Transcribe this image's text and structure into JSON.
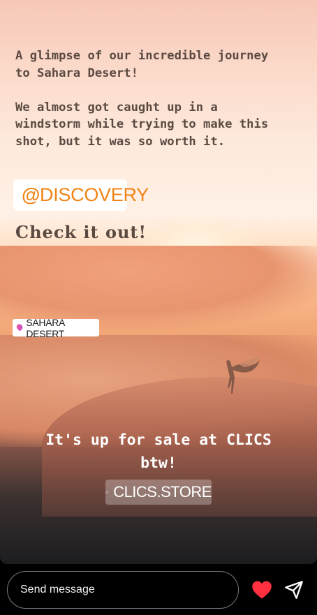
{
  "story": {
    "caption": "A glimpse of our incredible journey\nto Sahara Desert!\n\nWe almost got caught up in a\nwindstorm while trying to make this\nshot, but it was so worth it.",
    "mention": {
      "at": "@",
      "handle": "DISCOVERY",
      "color": "#f08416"
    },
    "cta": "Check it out!",
    "location": {
      "icon": "location-pin-icon",
      "label": "SAHARA DESERT"
    },
    "sale_text_line1": "It's up for sale at CLICS",
    "sale_text_line2": "btw!",
    "link": {
      "icon": "link-icon",
      "label": "CLICS.STORE"
    }
  },
  "reply_bar": {
    "placeholder": "Send message",
    "like_icon": "heart-icon",
    "like_color": "#ff3040",
    "send_icon": "send-icon"
  }
}
